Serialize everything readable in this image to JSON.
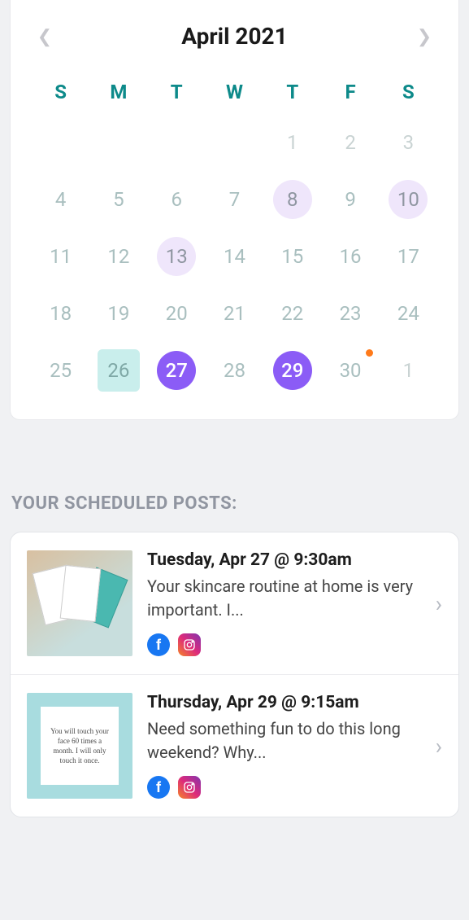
{
  "calendar": {
    "title": "April 2021",
    "dow": [
      "S",
      "M",
      "T",
      "W",
      "T",
      "F",
      "S"
    ],
    "days": [
      {
        "n": "",
        "cls": ""
      },
      {
        "n": "",
        "cls": ""
      },
      {
        "n": "",
        "cls": ""
      },
      {
        "n": "",
        "cls": ""
      },
      {
        "n": "1",
        "cls": "other-month"
      },
      {
        "n": "2",
        "cls": "other-month"
      },
      {
        "n": "3",
        "cls": "other-month"
      },
      {
        "n": "4",
        "cls": ""
      },
      {
        "n": "5",
        "cls": ""
      },
      {
        "n": "6",
        "cls": ""
      },
      {
        "n": "7",
        "cls": ""
      },
      {
        "n": "8",
        "cls": "light-marked"
      },
      {
        "n": "9",
        "cls": ""
      },
      {
        "n": "10",
        "cls": "light-marked"
      },
      {
        "n": "11",
        "cls": ""
      },
      {
        "n": "12",
        "cls": ""
      },
      {
        "n": "13",
        "cls": "light-marked"
      },
      {
        "n": "14",
        "cls": ""
      },
      {
        "n": "15",
        "cls": ""
      },
      {
        "n": "16",
        "cls": ""
      },
      {
        "n": "17",
        "cls": ""
      },
      {
        "n": "18",
        "cls": ""
      },
      {
        "n": "19",
        "cls": ""
      },
      {
        "n": "20",
        "cls": ""
      },
      {
        "n": "21",
        "cls": ""
      },
      {
        "n": "22",
        "cls": ""
      },
      {
        "n": "23",
        "cls": ""
      },
      {
        "n": "24",
        "cls": ""
      },
      {
        "n": "25",
        "cls": ""
      },
      {
        "n": "26",
        "cls": "today-box"
      },
      {
        "n": "27",
        "cls": "active"
      },
      {
        "n": "28",
        "cls": ""
      },
      {
        "n": "29",
        "cls": "active"
      },
      {
        "n": "30",
        "cls": "with-dot"
      },
      {
        "n": "1",
        "cls": "other-month"
      }
    ]
  },
  "section_title": "YOUR SCHEDULED POSTS:",
  "posts": [
    {
      "date": "Tuesday, Apr 27 @ 9:30am",
      "text": "Your skincare routine at home is very important. I...",
      "thumb_type": "skincare",
      "quote_text": "",
      "platforms": [
        "facebook",
        "instagram"
      ]
    },
    {
      "date": "Thursday, Apr 29 @ 9:15am",
      "text": "Need something fun to do this long weekend? Why...",
      "thumb_type": "quote",
      "quote_text": "You will touch your face 60 times a month. I will only touch it once.",
      "platforms": [
        "facebook",
        "instagram"
      ]
    }
  ]
}
